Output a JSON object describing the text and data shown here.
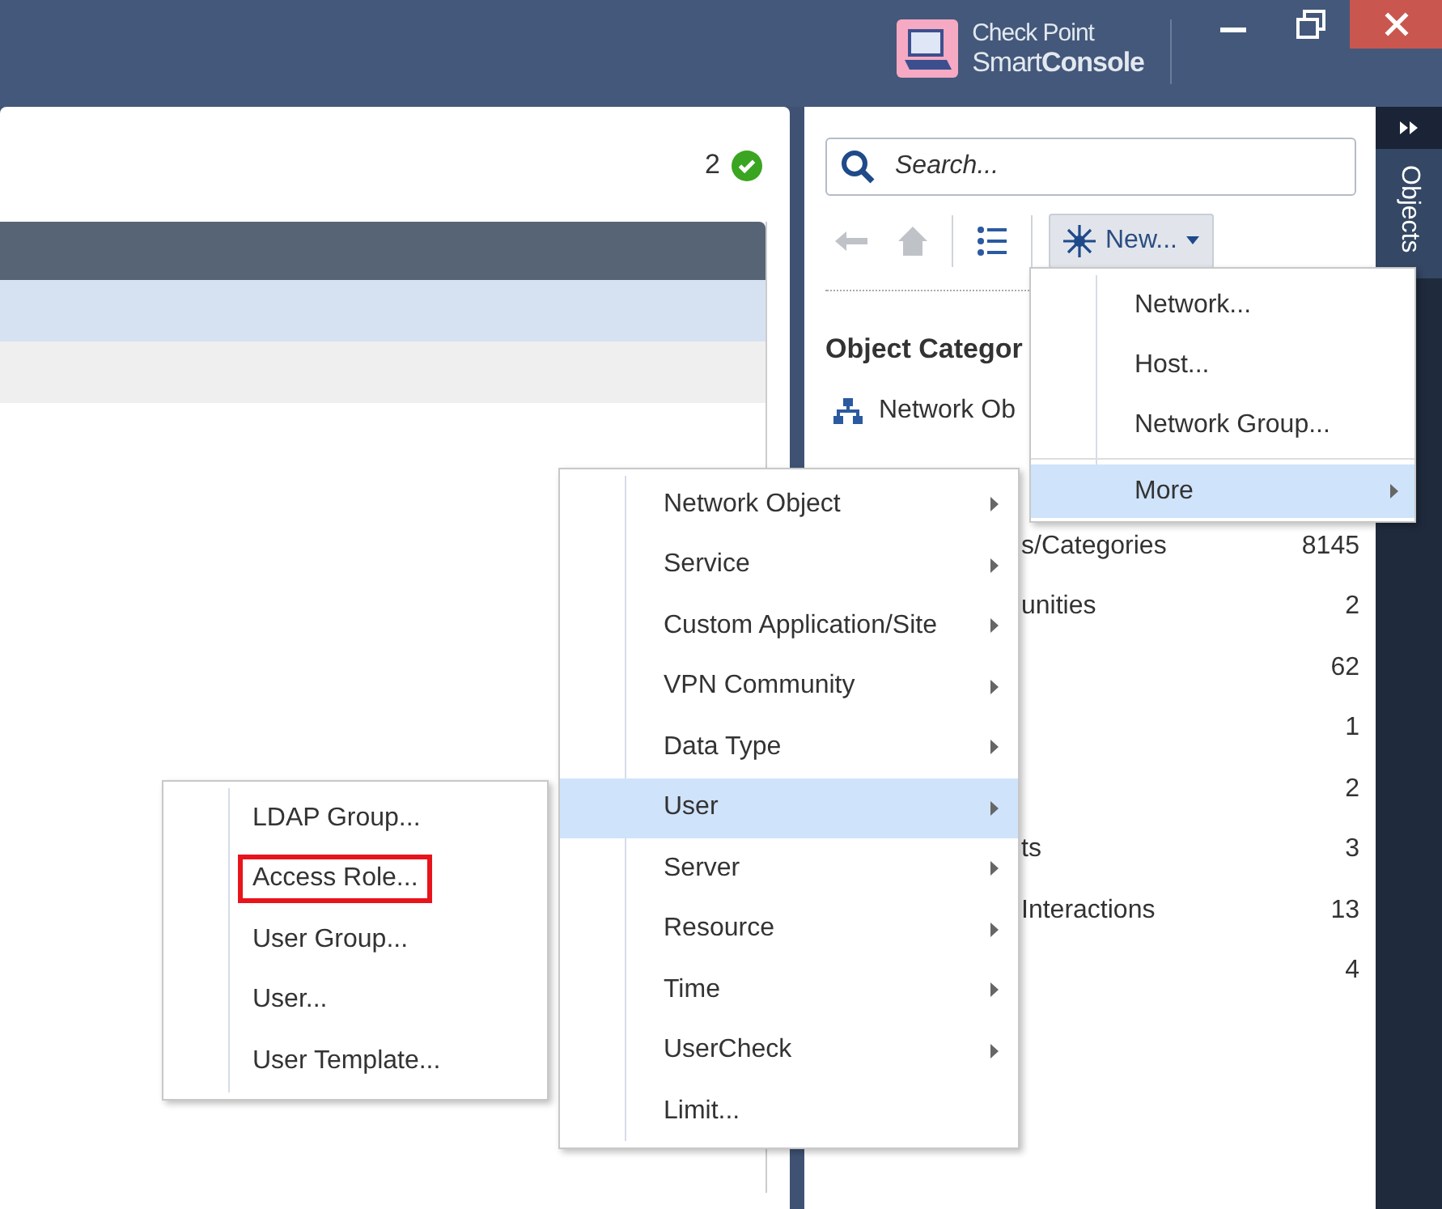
{
  "title_bar": {
    "brand_top": "Check Point",
    "brand_bottom": "Smart**Console**"
  },
  "status": {
    "count": "2",
    "ok": true
  },
  "table": {
    "rows": [
      {
        "selected": true
      },
      {
        "selected": false
      }
    ]
  },
  "search": {
    "placeholder": "Search..."
  },
  "toolbar": {
    "back_disabled": true,
    "home_disabled": true,
    "new_button": "New..."
  },
  "categories": {
    "title": "Object Categor",
    "first": "Network Ob",
    "rows": [
      {
        "label": "s/Categories",
        "count": "8145"
      },
      {
        "label": "unities",
        "count": "2"
      },
      {
        "label": "",
        "count": "62"
      },
      {
        "label": "",
        "count": "1"
      },
      {
        "label": "",
        "count": "2"
      },
      {
        "label": "ts",
        "count": "3"
      },
      {
        "label": "Interactions",
        "count": "13"
      },
      {
        "label": "",
        "count": "4"
      }
    ]
  },
  "side_tabs": [
    {
      "label": "Objects",
      "selected": true
    }
  ],
  "new_menu": {
    "items": [
      {
        "kind": "item",
        "label": "Network...",
        "selected": false,
        "submenu": false
      },
      {
        "kind": "item",
        "label": "Host...",
        "selected": false,
        "submenu": false
      },
      {
        "kind": "item",
        "label": "Network Group...",
        "selected": false,
        "submenu": false
      },
      {
        "kind": "separator"
      },
      {
        "kind": "item",
        "label": "More",
        "selected": true,
        "submenu": true
      }
    ]
  },
  "more_menu": {
    "items": [
      {
        "label": "Network Object",
        "selected": false,
        "submenu": true
      },
      {
        "label": "Service",
        "selected": false,
        "submenu": true
      },
      {
        "label": "Custom Application/Site",
        "selected": false,
        "submenu": true
      },
      {
        "label": "VPN Community",
        "selected": false,
        "submenu": true
      },
      {
        "label": "Data Type",
        "selected": false,
        "submenu": true
      },
      {
        "label": "User",
        "selected": true,
        "submenu": true
      },
      {
        "label": "Server",
        "selected": false,
        "submenu": true
      },
      {
        "label": "Resource",
        "selected": false,
        "submenu": true
      },
      {
        "label": "Time",
        "selected": false,
        "submenu": true
      },
      {
        "label": "UserCheck",
        "selected": false,
        "submenu": true
      },
      {
        "label": "Limit...",
        "selected": false,
        "submenu": false
      }
    ]
  },
  "user_menu": {
    "items": [
      {
        "label": "LDAP Group...",
        "highlighted": false
      },
      {
        "label": "Access Role...",
        "highlighted": true
      },
      {
        "label": "User Group...",
        "highlighted": false
      },
      {
        "label": "User...",
        "highlighted": false
      },
      {
        "label": "User Template...",
        "highlighted": false
      }
    ]
  }
}
